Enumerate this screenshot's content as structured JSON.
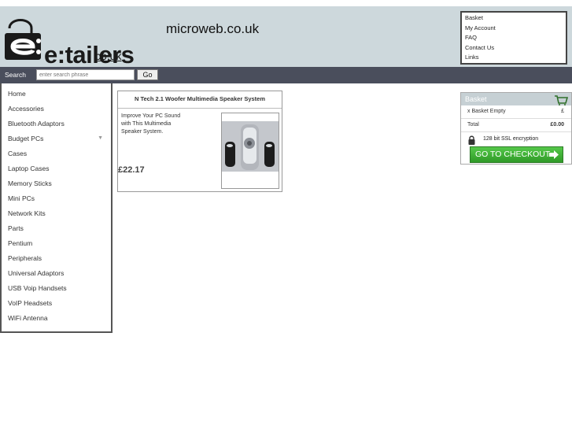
{
  "header": {
    "logo_text": "e:tailers",
    "logo_suffix": "co.uk",
    "site_title": "microweb.co.uk",
    "background_color": "#cdd8dc"
  },
  "top_links": [
    "Basket",
    "My Account",
    "FAQ",
    "Contact Us",
    "Links"
  ],
  "search": {
    "label": "Search",
    "placeholder": "enter search phrase",
    "go_label": "Go"
  },
  "categories": [
    "Home",
    "Accessories",
    "Bluetooth Adaptors",
    "Budget PCs",
    "Cases",
    "Laptop Cases",
    "Memory Sticks",
    "Mini PCs",
    "Network Kits",
    "Parts",
    "Pentium",
    "Peripherals",
    "Universal Adaptors",
    "USB Voip Handsets",
    "VoIP Headsets",
    "WiFi Antenna"
  ],
  "product": {
    "title": "N Tech 2.1 Woofer Multimedia Speaker System",
    "desc_lines": [
      "Improve Your PC Sound",
      "with This Multimedia",
      "Speaker System."
    ],
    "price": "£22.17"
  },
  "basket": {
    "title": "Basket",
    "empty_label": "x Basket Empty",
    "empty_currency": "£",
    "total_label": "Total",
    "total_value": "£0.00",
    "ssl_text": "128 bit SSL encryption",
    "checkout_label": "GO TO CHECKOUT",
    "checkout_color": "#3aa82f"
  },
  "icons": [
    "e-logo-icon",
    "cart-icon",
    "lock-icon",
    "arrow-right-icon",
    "chevron-down-icon"
  ]
}
